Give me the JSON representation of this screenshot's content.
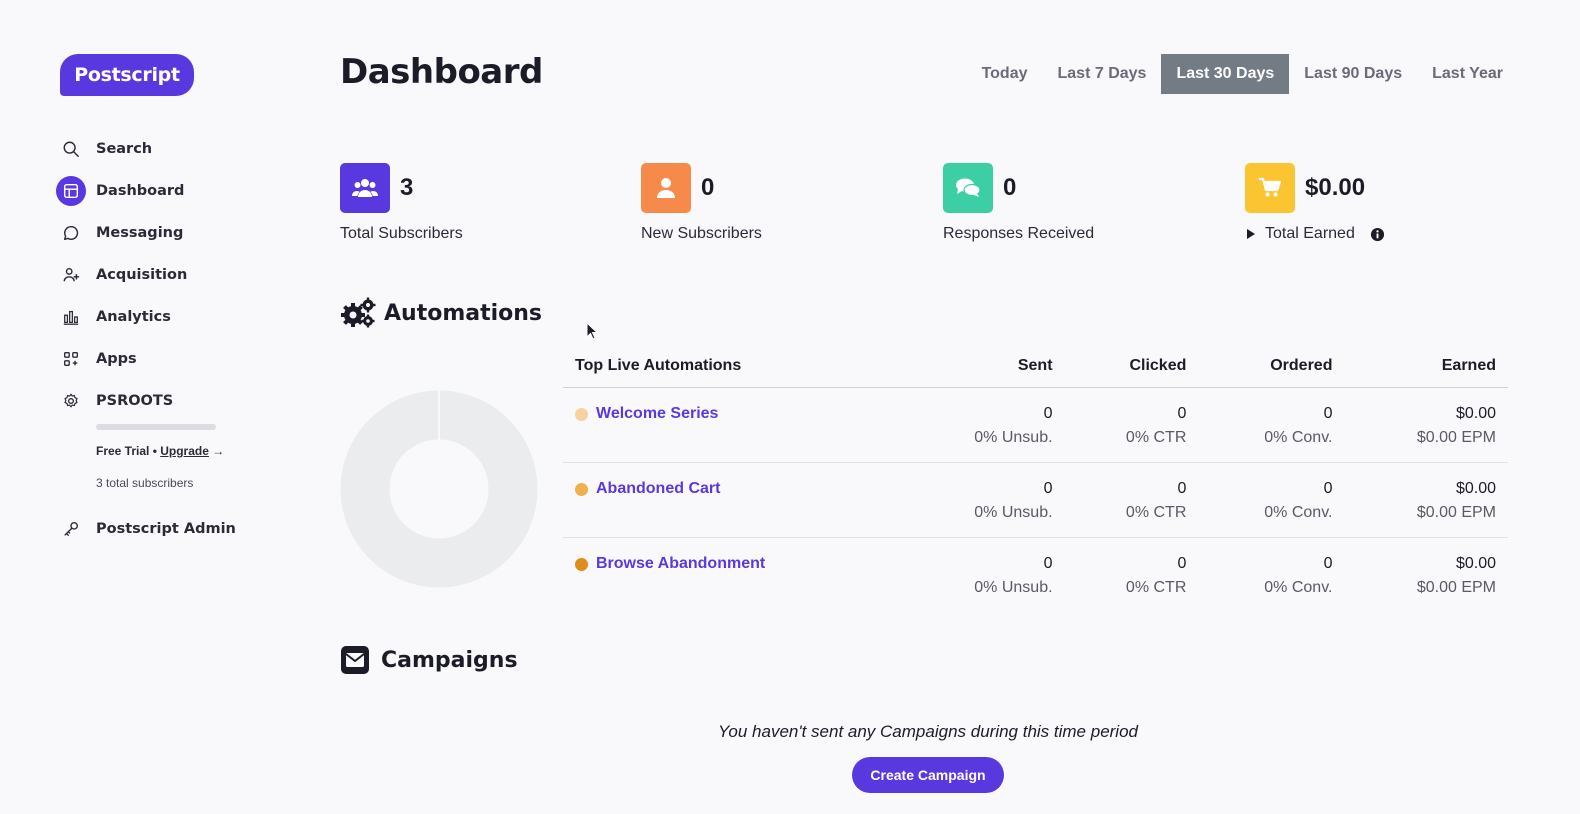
{
  "brand": {
    "logo_text": "Postscript",
    "accent": "#5a38e0"
  },
  "sidebar": {
    "items": [
      {
        "label": "Search",
        "icon": "search-icon"
      },
      {
        "label": "Dashboard",
        "icon": "dashboard-icon",
        "active": true
      },
      {
        "label": "Messaging",
        "icon": "message-icon"
      },
      {
        "label": "Acquisition",
        "icon": "add-user-icon"
      },
      {
        "label": "Analytics",
        "icon": "bar-chart-icon"
      },
      {
        "label": "Apps",
        "icon": "apps-icon"
      },
      {
        "label": "PSROOTS",
        "icon": "gear-icon"
      },
      {
        "label": "Postscript Admin",
        "icon": "key-icon"
      }
    ],
    "trial_prefix": "Free Trial • ",
    "upgrade_label": "Upgrade",
    "upgrade_arrow": "→",
    "subscriber_note": "3 total subscribers"
  },
  "header": {
    "title": "Dashboard",
    "ranges": [
      "Today",
      "Last 7 Days",
      "Last 30 Days",
      "Last 90 Days",
      "Last Year"
    ],
    "active_range": "Last 30 Days"
  },
  "stats": [
    {
      "value": "3",
      "label": "Total Subscribers",
      "color": "#5a38e0",
      "icon": "users-icon"
    },
    {
      "value": "0",
      "label": "New Subscribers",
      "color": "#f58a4b",
      "icon": "user-icon"
    },
    {
      "value": "0",
      "label": "Responses Received",
      "color": "#3ccfa6",
      "icon": "chat-icon"
    },
    {
      "value": "$0.00",
      "label": "Total Earned",
      "color": "#fbc531",
      "icon": "cart-icon"
    }
  ],
  "automations": {
    "title": "Automations",
    "columns": [
      "Top Live Automations",
      "Sent",
      "Clicked",
      "Ordered",
      "Earned"
    ],
    "rows": [
      {
        "name": "Welcome Series",
        "dot": "#f5d1a3",
        "sent": "0",
        "sent_sub": "0% Unsub.",
        "clicked": "0",
        "clicked_sub": "0% CTR",
        "ordered": "0",
        "ordered_sub": "0% Conv.",
        "earned": "$0.00",
        "earned_sub": "$0.00 EPM"
      },
      {
        "name": "Abandoned Cart",
        "dot": "#f0b04b",
        "sent": "0",
        "sent_sub": "0% Unsub.",
        "clicked": "0",
        "clicked_sub": "0% CTR",
        "ordered": "0",
        "ordered_sub": "0% Conv.",
        "earned": "$0.00",
        "earned_sub": "$0.00 EPM"
      },
      {
        "name": "Browse Abandonment",
        "dot": "#e08c1c",
        "sent": "0",
        "sent_sub": "0% Unsub.",
        "clicked": "0",
        "clicked_sub": "0% CTR",
        "ordered": "0",
        "ordered_sub": "0% Conv.",
        "earned": "$0.00",
        "earned_sub": "$0.00 EPM"
      }
    ]
  },
  "campaigns": {
    "title": "Campaigns",
    "empty_message": "You haven't sent any Campaigns during this time period",
    "create_label": "Create Campaign"
  }
}
